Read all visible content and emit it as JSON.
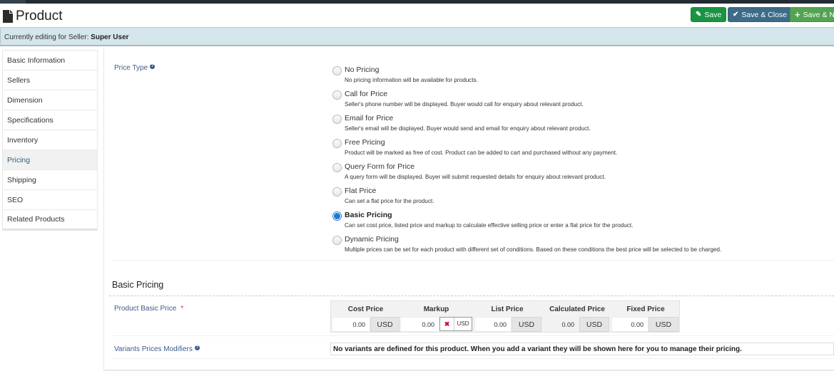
{
  "header": {
    "title": "Product",
    "title_icon": "file-icon",
    "buttons": {
      "save": {
        "label": "Save",
        "icon": "edit-icon",
        "color": "#1a9443"
      },
      "save_close": {
        "label": "Save & Close",
        "icon": "check-icon",
        "color": "#3d6b88"
      },
      "save_new": {
        "label": "Save & New",
        "icon": "plus-icon",
        "color": "#52a452"
      }
    }
  },
  "seller_bar": {
    "prefix": "Currently editing for Seller: ",
    "seller": "Super User"
  },
  "sidebar": {
    "items": [
      {
        "label": "Basic Information",
        "active": false
      },
      {
        "label": "Sellers",
        "active": false
      },
      {
        "label": "Dimension",
        "active": false
      },
      {
        "label": "Specifications",
        "active": false
      },
      {
        "label": "Inventory",
        "active": false
      },
      {
        "label": "Pricing",
        "active": true
      },
      {
        "label": "Shipping",
        "active": false
      },
      {
        "label": "SEO",
        "active": false
      },
      {
        "label": "Related Products",
        "active": false
      }
    ]
  },
  "price_type": {
    "label": "Price Type",
    "selected": "Basic Pricing",
    "options": [
      {
        "title": "No Pricing",
        "desc": "No pricing information will be available for products."
      },
      {
        "title": "Call for Price",
        "desc": "Seller's phone number will be displayed. Buyer would call for enquiry about relevant product."
      },
      {
        "title": "Email for Price",
        "desc": "Seller's email will be displayed. Buyer would send and email for enquiry about relevant product."
      },
      {
        "title": "Free Pricing",
        "desc": "Product will be marked as free of cost. Product can be added to cart and purchased without any payment."
      },
      {
        "title": "Query Form for Price",
        "desc": "A query form will be displayed. Buyer will submit requested details for enquiry about relevant product."
      },
      {
        "title": "Flat Price",
        "desc": "Can set a flat price for the product."
      },
      {
        "title": "Basic Pricing",
        "desc": "Can set cost price, listed price and markup to calculate effective selling price or enter a flat price for the product."
      },
      {
        "title": "Dynamic Pricing",
        "desc": "Multiple prices can be set for each product with different set of conditions. Based on these conditions the best price will be selected to be charged."
      }
    ]
  },
  "basic_pricing": {
    "section_title": "Basic Pricing",
    "product_basic_price_label": "Product Basic Price",
    "required_marker": "*",
    "columns": [
      {
        "header": "Cost Price",
        "value": "0.00",
        "currency": "USD"
      },
      {
        "header": "Markup",
        "value": "0.00",
        "toggle_x": "✖",
        "currency": "USD"
      },
      {
        "header": "List Price",
        "value": "0.00",
        "currency": "USD"
      },
      {
        "header": "Calculated Price",
        "value": "0.00",
        "currency": "USD"
      },
      {
        "header": "Fixed Price",
        "value": "0.00",
        "currency": "USD"
      }
    ],
    "variants_label": "Variants Prices Modifiers",
    "variants_message": "No variants are defined for this product. When you add a variant they will be shown here for you to manage their pricing."
  }
}
